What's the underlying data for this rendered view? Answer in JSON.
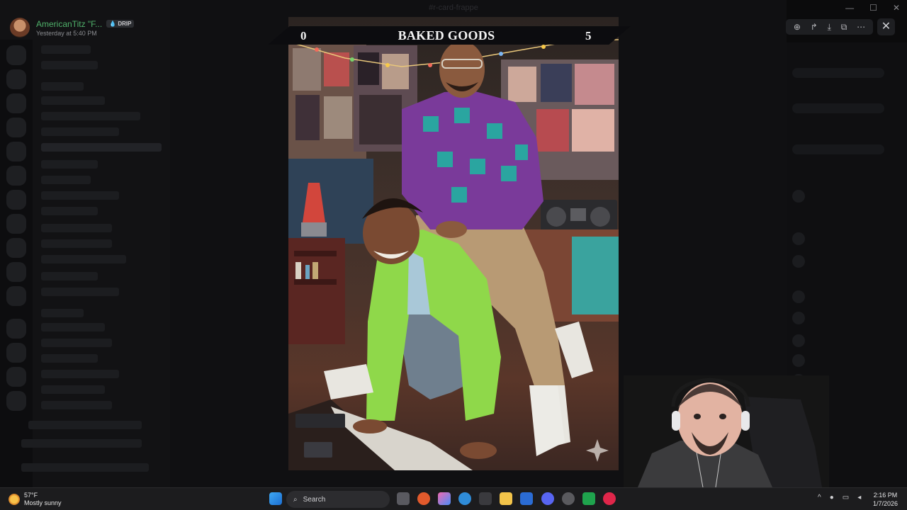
{
  "window": {
    "title": "#r-card-frappe",
    "controls": [
      "—",
      "☐",
      "✕"
    ]
  },
  "uploader": {
    "name": "AmericanTitz \"F...",
    "badge": "DRIP",
    "timestamp": "Yesterday at 5:40 PM"
  },
  "viewer_tools": [
    {
      "icon": "zoom-icon",
      "glyph": "⊕"
    },
    {
      "icon": "forward-icon",
      "glyph": "↱"
    },
    {
      "icon": "download-icon",
      "glyph": "⤓"
    },
    {
      "icon": "open-external-icon",
      "glyph": "⧉"
    },
    {
      "icon": "more-icon",
      "glyph": "⋯"
    }
  ],
  "close_glyph": "✕",
  "card": {
    "left_score": "0",
    "title": "BAKED GOODS",
    "right_score": "5"
  },
  "taskbar": {
    "weather_temp": "57°F",
    "weather_desc": "Mostly sunny",
    "search_placeholder": "Search",
    "time": "2:16 PM",
    "date": "1/7/2026"
  },
  "colors": {
    "accent_green": "#4fb16a",
    "banner": "#0c0c0f",
    "shirt_green": "#8fd84a",
    "shirt_purple": "#7a3a9a",
    "shirt_teal": "#2aa5a0"
  }
}
